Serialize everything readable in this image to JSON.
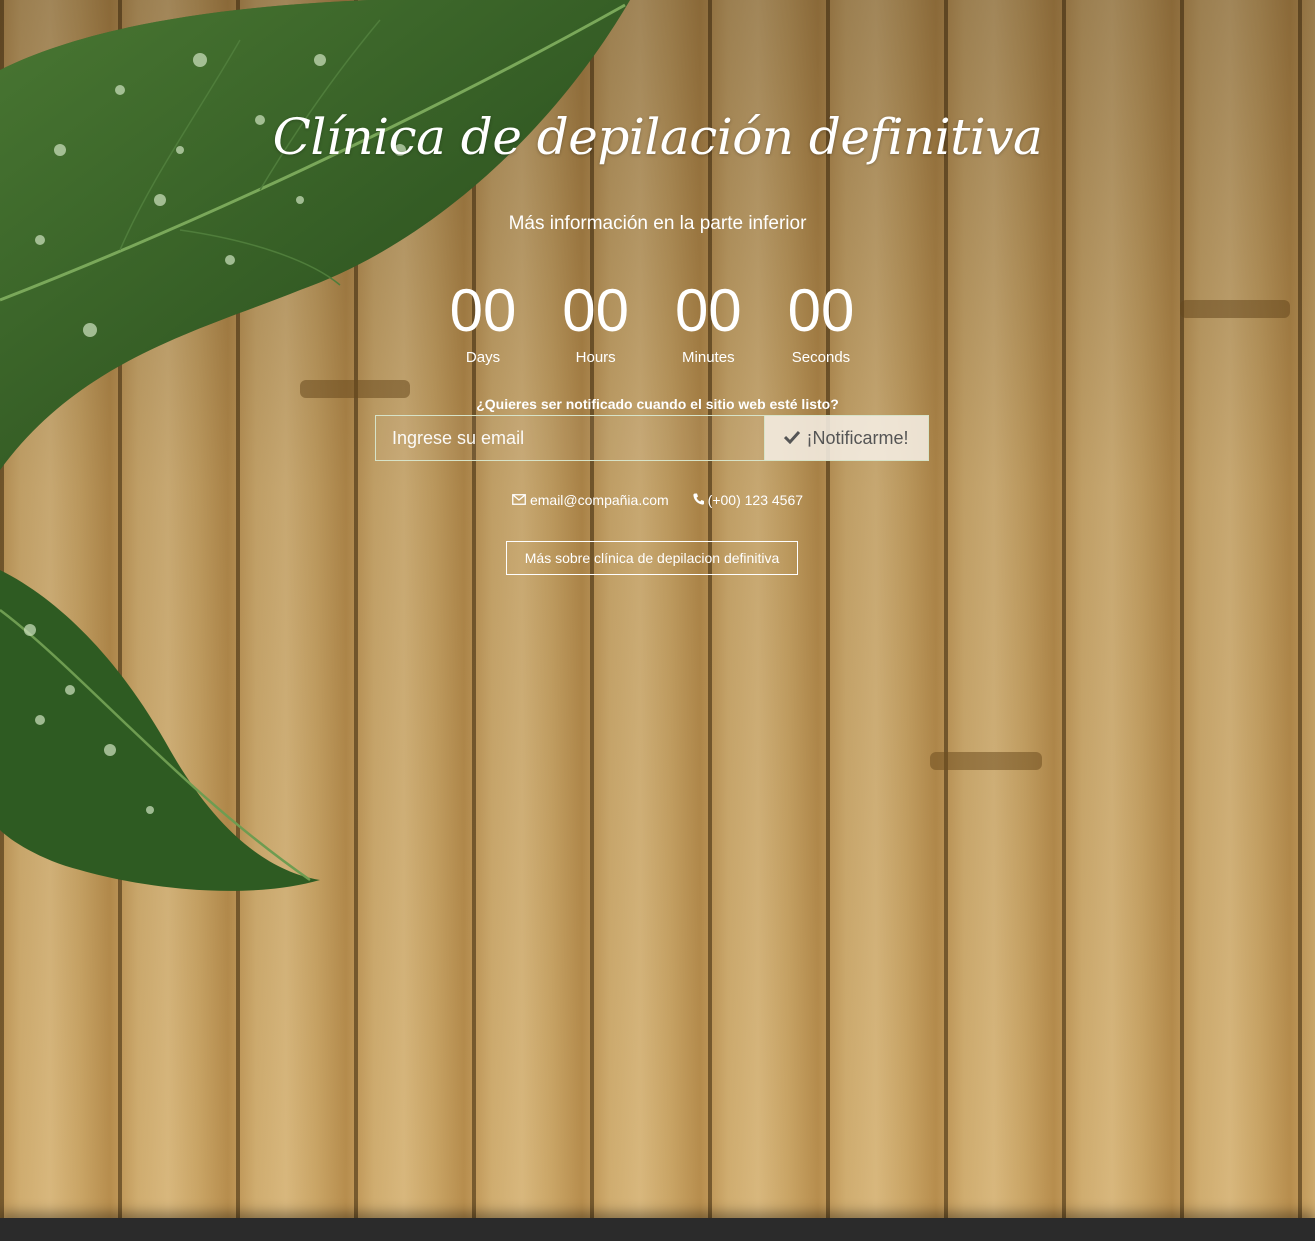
{
  "hero": {
    "title": "Clínica de depilación definitiva",
    "subtitle": "Más información en la parte inferior"
  },
  "countdown": [
    {
      "value": "00",
      "label": "Days"
    },
    {
      "value": "00",
      "label": "Hours"
    },
    {
      "value": "00",
      "label": "Minutes"
    },
    {
      "value": "00",
      "label": "Seconds"
    }
  ],
  "notify": {
    "question": "¿Quieres ser notificado cuando el sitio web esté listo?",
    "email_placeholder": "Ingrese su email",
    "button_label": "¡Notificarme!",
    "button_icon": "check-icon"
  },
  "contact": {
    "email": "email@compañia.com",
    "email_icon": "envelope-icon",
    "phone": "(+00) 123 4567",
    "phone_icon": "phone-icon"
  },
  "more_button": {
    "label": "Más sobre clínica de depilacion definitiva"
  },
  "colors": {
    "text": "#ffffff",
    "button_bg": "#f5eee4",
    "border": "#d7e3c8",
    "footer": "#2b2b2b"
  }
}
